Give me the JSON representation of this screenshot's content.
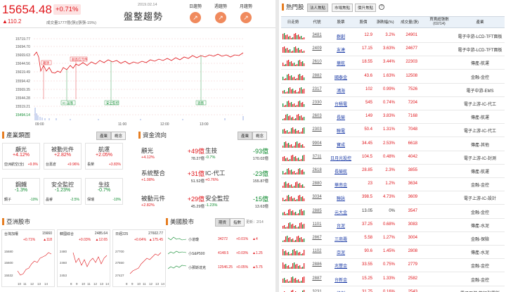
{
  "index": {
    "value": "15654.48",
    "pct": "+0.71%",
    "change": "▲110.2",
    "volume": "成交量1777億(張)(張張-15%)",
    "date": "2019.02.14",
    "trend": "盤整趨勢"
  },
  "trend_buttons": [
    {
      "label": "日趨勢",
      "icon": "trend-up-icon"
    },
    {
      "label": "週趨勢",
      "icon": "trend-up-icon"
    },
    {
      "label": "月趨勢",
      "icon": "trend-up-icon"
    }
  ],
  "chart": {
    "y_ticks": [
      "15719.77",
      "15694.70",
      "15669.63",
      "15644.56",
      "15619.49",
      "15594.42",
      "15569.35",
      "15544.28",
      "15519.21",
      "15494.14"
    ],
    "x_ticks": [
      "09:00",
      "11:00",
      "12:00",
      "13:00"
    ],
    "labels": [
      "箱頂",
      "創高信元件",
      "IC-設落",
      "安全監控",
      "遊戲"
    ]
  },
  "industry": {
    "title": "產業類圖",
    "tabs": [
      "產業",
      "概念"
    ],
    "cards": [
      {
        "name": "顧光",
        "pct": "+4.12%",
        "leader": "亞洲航空(全)",
        "lead_pct": "+9.9%"
      },
      {
        "name": "被動元件",
        "pct": "+2.82%",
        "leader": "台嘉倉",
        "lead_pct": "+9.96%"
      },
      {
        "name": "航運",
        "pct": "+2.05%",
        "leader": "長榮",
        "lead_pct": "+3.83%"
      },
      {
        "name": "鋼鐵",
        "pct": "-1.3%",
        "leader": "鋼子",
        "lead_pct": "-10%"
      },
      {
        "name": "安全監控",
        "pct": "-1.23%",
        "leader": "晶睿",
        "lead_pct": "-2.5%"
      },
      {
        "name": "生技",
        "pct": "-0.7%",
        "leader": "保瑞",
        "lead_pct": "-10%"
      }
    ]
  },
  "flow": {
    "title": "資金流向",
    "tabs": [
      "產業",
      "概念"
    ],
    "left": [
      {
        "name": "顧光",
        "amount": "+49億",
        "pct": "+4.12%",
        "vol": "78.27億"
      },
      {
        "name": "系統整合",
        "amount": "+31億",
        "pct": "+1.08%",
        "vol": "51.52億"
      },
      {
        "name": "被動元件",
        "amount": "+29億",
        "pct": "+2.82%",
        "vol": "45.29億"
      }
    ],
    "right": [
      {
        "name": "生技",
        "amount": "-93億",
        "pct": "-0.7%",
        "vol": "170.02億"
      },
      {
        "name": "IC-代工",
        "amount": "-23億",
        "pct": "+0.76%",
        "vol": "155.87億"
      },
      {
        "name": "安全監控",
        "amount": "-15億",
        "pct": "-1.23%",
        "vol": "13.63億"
      }
    ]
  },
  "asia": {
    "title": "亞洲股市",
    "cards": [
      {
        "name": "台灣加權",
        "value": "15660",
        "pct": "+0.71%",
        "chg": "▲118",
        "ticks": [
          "15680",
          "15600",
          "15532"
        ]
      },
      {
        "name": "韓國綜合",
        "value": "2485.64",
        "pct": "+0.03%",
        "chg": "▲12.65",
        "ticks": [
          "2480",
          "2460",
          "2453"
        ]
      },
      {
        "name": "日經225",
        "value": "27602.77",
        "pct": "+0.64%",
        "chg": "▲175.45",
        "ticks": [
          "27700",
          "27550",
          "27427"
        ]
      }
    ],
    "x_ticks": [
      "8",
      "9",
      "10",
      "11",
      "12",
      "13",
      "14"
    ]
  },
  "us": {
    "title": "美國股市",
    "tabs": [
      "期貨",
      "指數"
    ],
    "note": "更新：2/14",
    "rows": [
      {
        "name": "小道瓊",
        "price": "34272",
        "pct": "+0.01%",
        "chg": "▲4"
      },
      {
        "name": "小S&P500",
        "price": "4148.5",
        "pct": "+0.03%",
        "chg": "▲1.25"
      },
      {
        "name": "小那斯達克",
        "price": "12546.25",
        "pct": "+0.05%",
        "chg": "▲5.75"
      }
    ]
  },
  "hot": {
    "title": "熱門股",
    "tabs": [
      "法人焦點",
      "市場焦點",
      "價升焦點"
    ],
    "help": "?",
    "headers": [
      "日走勢",
      "代號",
      "股票",
      "股價",
      "漲跌幅(%)",
      "成交量(張)",
      "買賣超張數(02/14)",
      "產業"
    ],
    "rows": [
      {
        "code": "3481",
        "name": "群創",
        "price": "12.9",
        "pct": "3.2%",
        "amt": "24901",
        "vol": "",
        "ind": "電子中游-LCD-TFT面板"
      },
      {
        "code": "2409",
        "name": "友達",
        "price": "17.15",
        "pct": "3.63%",
        "amt": "24677",
        "vol": "",
        "ind": "電子中游-LCD-TFT面板"
      },
      {
        "code": "2610",
        "name": "華航",
        "price": "18.55",
        "pct": "3.44%",
        "amt": "22303",
        "vol": "",
        "ind": "傳產-航運"
      },
      {
        "code": "2882",
        "name": "國泰金",
        "price": "43.6",
        "pct": "1.63%",
        "amt": "12508",
        "vol": "",
        "ind": "金融-金控"
      },
      {
        "code": "2317",
        "name": "鴻海",
        "price": "102",
        "pct": "0.99%",
        "amt": "7526",
        "vol": "",
        "ind": "電子中游-EMS"
      },
      {
        "code": "2330",
        "name": "台積電",
        "price": "545",
        "pct": "0.74%",
        "amt": "7204",
        "vol": "",
        "ind": "電子上游-IC-代工"
      },
      {
        "code": "2603",
        "name": "長榮",
        "price": "149",
        "pct": "3.83%",
        "amt": "7168",
        "vol": "",
        "ind": "傳產-航運"
      },
      {
        "code": "2303",
        "name": "聯電",
        "price": "50.4",
        "pct": "1.31%",
        "amt": "7048",
        "vol": "",
        "ind": "電子上游-IC-代工"
      },
      {
        "code": "9904",
        "name": "寶成",
        "price": "34.45",
        "pct": "2.53%",
        "amt": "6618",
        "vol": "",
        "ind": "傳產-其他"
      },
      {
        "code": "3711",
        "name": "日月光投控",
        "price": "104.5",
        "pct": "0.48%",
        "amt": "4042",
        "vol": "",
        "ind": "電子上游-IC-封測"
      },
      {
        "code": "2618",
        "name": "長榮航",
        "price": "28.85",
        "pct": "2.3%",
        "amt": "3855",
        "vol": "",
        "ind": "傳產-航運"
      },
      {
        "code": "2880",
        "name": "華南金",
        "price": "23",
        "pct": "1.2%",
        "amt": "3634",
        "vol": "",
        "ind": "金融-金控"
      },
      {
        "code": "3034",
        "name": "聯詠",
        "price": "398.5",
        "pct": "4.73%",
        "amt": "3609",
        "vol": "",
        "ind": "電子上游-IC-設計"
      },
      {
        "code": "2885",
        "name": "元大金",
        "price": "13.05",
        "pct": "0%",
        "amt": "3547",
        "vol": "",
        "ind": "金融-金控"
      },
      {
        "code": "1101",
        "name": "台泥",
        "price": "37.25",
        "pct": "0.68%",
        "amt": "3083",
        "vol": "",
        "ind": "傳產-水泥"
      },
      {
        "code": "2867",
        "name": "三商壽",
        "price": "5.58",
        "pct": "1.27%",
        "amt": "3004",
        "vol": "",
        "ind": "金融-保險"
      },
      {
        "code": "1102",
        "name": "亞泥",
        "price": "90.6",
        "pct": "1.45%",
        "amt": "2808",
        "vol": "",
        "ind": "傳產-水泥"
      },
      {
        "code": "2886",
        "name": "兆豐金",
        "price": "33.55",
        "pct": "0.75%",
        "amt": "2779",
        "vol": "",
        "ind": "金融-金控"
      },
      {
        "code": "2887",
        "name": "台新金",
        "price": "15.25",
        "pct": "1.33%",
        "amt": "2582",
        "vol": "",
        "ind": "金融-金控"
      },
      {
        "code": "3231",
        "name": "緯創",
        "price": "31.75",
        "pct": "0.16%",
        "amt": "2543",
        "vol": "",
        "ind": "電子下游-筆記型電腦"
      }
    ]
  }
}
